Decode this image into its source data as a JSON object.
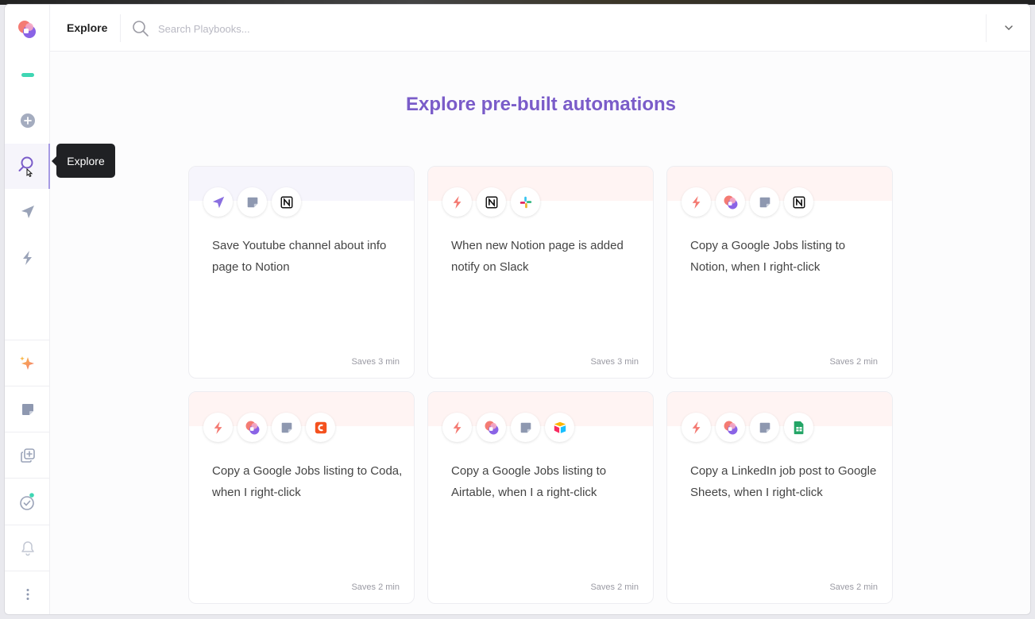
{
  "topbar": {
    "title": "Explore",
    "search_placeholder": "Search Playbooks..."
  },
  "tooltip": {
    "label": "Explore"
  },
  "heading": "Explore pre-built automations",
  "sidebar": {
    "items": [
      {
        "icon": "dash-icon"
      },
      {
        "icon": "plus-circle-icon"
      },
      {
        "icon": "search-icon"
      },
      {
        "icon": "send-icon"
      },
      {
        "icon": "lightning-icon"
      },
      {
        "icon": "sparkle-icon"
      },
      {
        "icon": "note-icon"
      },
      {
        "icon": "duplicate-icon"
      },
      {
        "icon": "check-circle-icon"
      },
      {
        "icon": "bell-icon"
      },
      {
        "icon": "more-icon"
      }
    ]
  },
  "colors": {
    "accent": "#7a5cc9",
    "teal": "#3fd6b3",
    "red": "#f47b73"
  },
  "cards": [
    {
      "title": "Save Youtube channel about info page to Notion",
      "saves": "Saves 3 min",
      "icons": [
        "send-icon",
        "note-icon",
        "notion-icon"
      ]
    },
    {
      "title": "When new Notion page is added notify on Slack",
      "saves": "Saves 3 min",
      "icons": [
        "lightning-icon",
        "notion-icon",
        "slack-icon"
      ]
    },
    {
      "title": "Copy a Google Jobs listing to Notion, when I right-click",
      "saves": "Saves 2 min",
      "icons": [
        "lightning-icon",
        "bardeen-icon",
        "note-icon",
        "notion-icon"
      ]
    },
    {
      "title": "Copy a Google Jobs listing to Coda, when I right-click",
      "saves": "Saves 2 min",
      "icons": [
        "lightning-icon",
        "bardeen-icon",
        "note-icon",
        "coda-icon"
      ]
    },
    {
      "title": "Copy a Google Jobs listing to Airtable, when I a right-click",
      "saves": "Saves 2 min",
      "icons": [
        "lightning-icon",
        "bardeen-icon",
        "note-icon",
        "airtable-icon"
      ]
    },
    {
      "title": "Copy a LinkedIn job post to Google Sheets, when I right-click",
      "saves": "Saves 2 min",
      "icons": [
        "lightning-icon",
        "bardeen-icon",
        "note-icon",
        "sheets-icon"
      ]
    }
  ]
}
